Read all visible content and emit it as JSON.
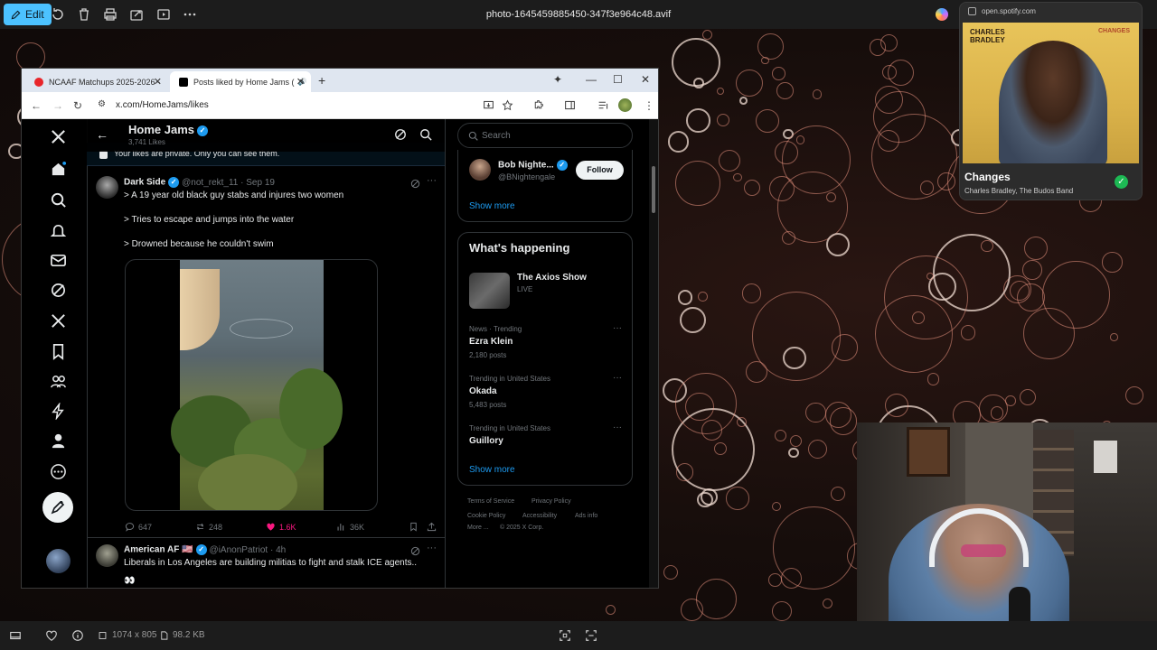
{
  "viewer": {
    "edit_label": "Edit",
    "filename": "photo-1645459885450-347f3e964c48.avif",
    "dimensions": "1074 x 805",
    "file_size": "98.2 KB"
  },
  "browser": {
    "tabs": [
      {
        "label": "NCAAF Matchups 2025-2026 -",
        "favicon_color": "#e8252a"
      },
      {
        "label": "Posts liked by Home Jams (",
        "favicon_color": "#000000"
      }
    ],
    "url": "x.com/HomeJams/likes"
  },
  "x": {
    "profile_name": "Home Jams",
    "likes_count": "3,741 Likes",
    "private_notice": "Your likes are private. Only you can see them.",
    "tweets": [
      {
        "name": "Dark Side",
        "handle": "@not_rekt_11 · Sep 19",
        "lines": [
          "> A 19 year old black guy stabs and injures two women",
          "> Tries to escape and jumps into the water",
          "> Drowned because he couldn't swim"
        ],
        "replies": "647",
        "reposts": "248",
        "likes": "1.6K",
        "views": "36K"
      },
      {
        "name": "American AF 🇺🇸",
        "handle": "@iAnonPatriot · 4h",
        "lines": [
          "Liberals in Los Angeles are building militias to fight and stalk ICE agents.."
        ],
        "emoji": "👀"
      }
    ],
    "search_placeholder": "Search",
    "who_to_follow": {
      "name": "Bob Nighte...",
      "handle": "@BNightengale",
      "follow_label": "Follow",
      "show_more": "Show more"
    },
    "whats_happening": {
      "title": "What's happening",
      "live_title": "The Axios Show",
      "live_label": "LIVE",
      "trends": [
        {
          "meta": "News · Trending",
          "name": "Ezra Klein",
          "posts": "2,180 posts"
        },
        {
          "meta": "Trending in United States",
          "name": "Okada",
          "posts": "5,483 posts"
        },
        {
          "meta": "Trending in United States",
          "name": "Guillory",
          "posts": ""
        }
      ],
      "show_more": "Show more"
    },
    "footer": {
      "terms": "Terms of Service",
      "privacy": "Privacy Policy",
      "cookie": "Cookie Policy",
      "accessibility": "Accessibility",
      "ads": "Ads info",
      "more": "More ...",
      "copyright": "© 2025 X Corp."
    }
  },
  "spotify": {
    "url": "open.spotify.com",
    "album_artist_cover": "CHARLES BRADLEY",
    "album_title_cover": "CHANGES",
    "track": "Changes",
    "artist": "Charles Bradley, The Budos Band"
  },
  "colors": {
    "x_blue": "#1d9bf0",
    "like_pink": "#f91880",
    "spotify_green": "#1db954",
    "edit_accent": "#4cc2ff"
  }
}
